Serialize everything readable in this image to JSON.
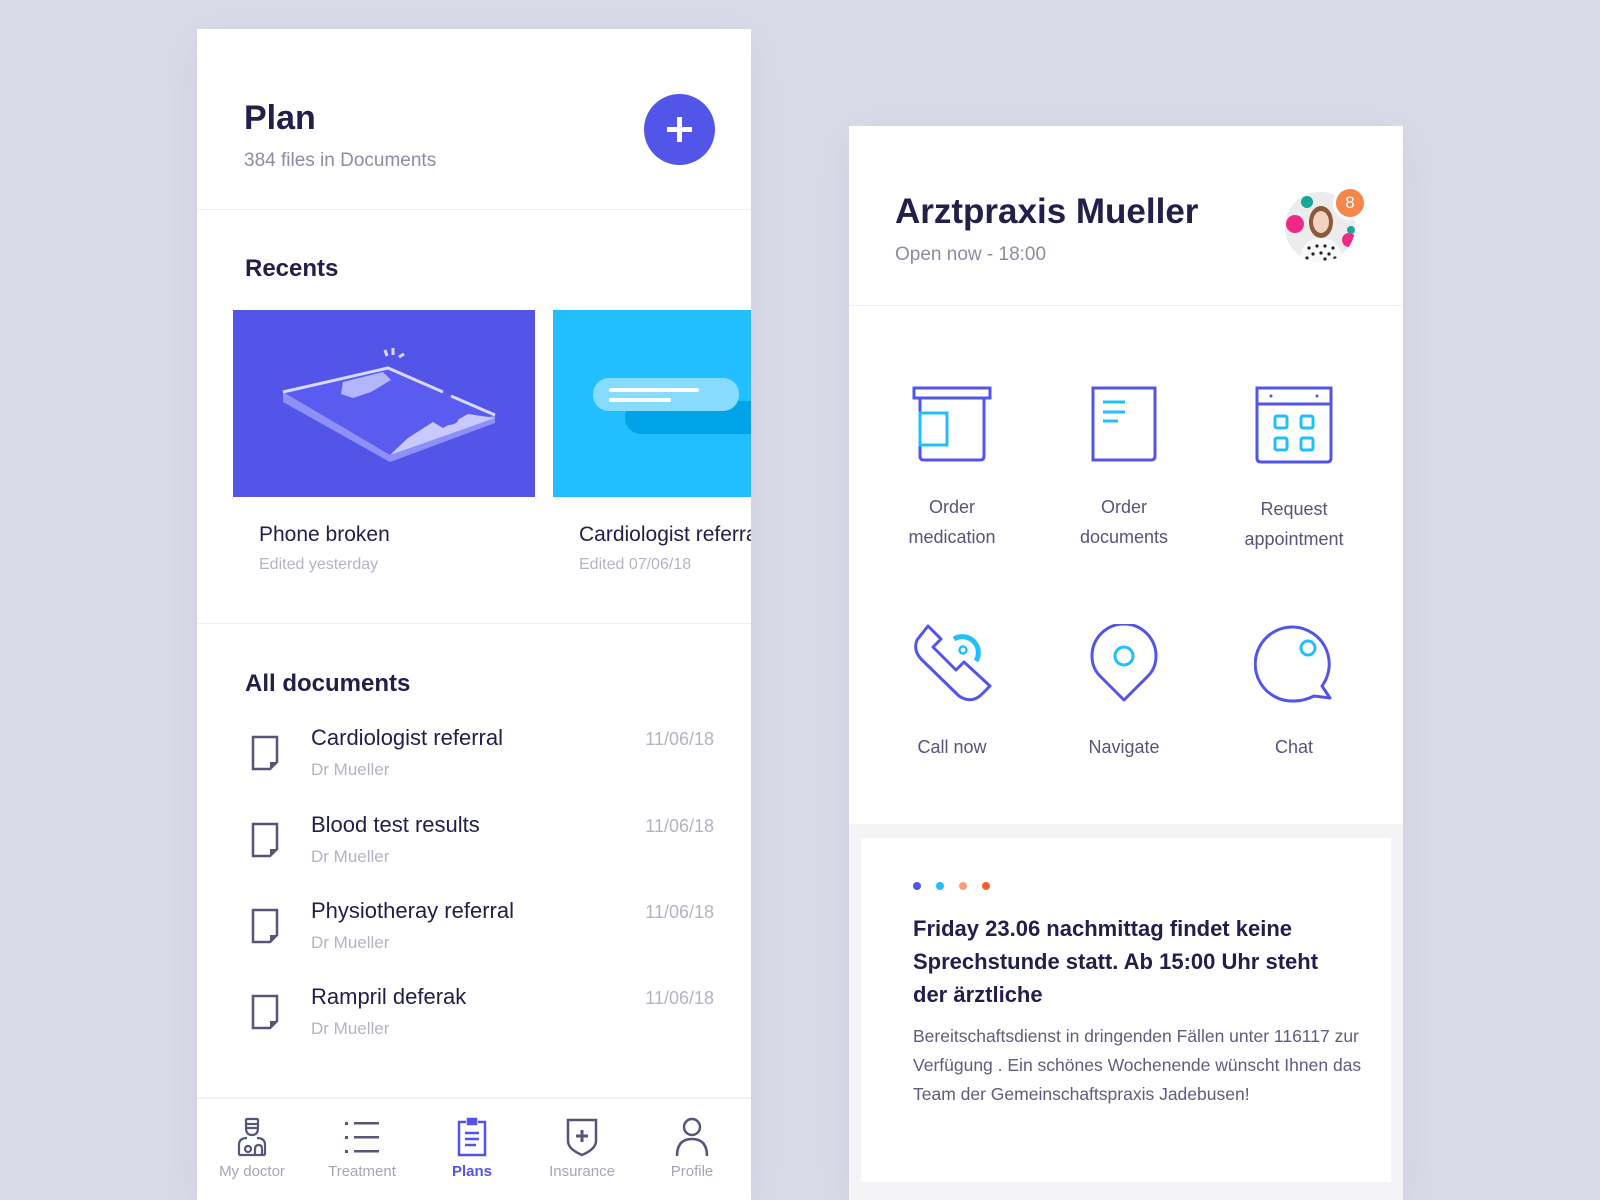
{
  "left_screen": {
    "header": {
      "title": "Plan",
      "subtitle": "384 files in Documents",
      "add_button_label": "+"
    },
    "recents": {
      "title": "Recents",
      "items": [
        {
          "title": "Phone broken",
          "subtitle": "Edited yesterday",
          "thumb_color": "#5255e8",
          "illustration": "broken-phone-illustration"
        },
        {
          "title": "Cardiologist referral",
          "subtitle": "Edited 07/06/18",
          "thumb_color": "#22bfff",
          "illustration": "chat-bubble-illustration"
        }
      ]
    },
    "all_documents": {
      "title": "All documents",
      "items": [
        {
          "title": "Cardiologist referral",
          "author": "Dr Mueller",
          "date": "11/06/18"
        },
        {
          "title": "Blood test results",
          "author": "Dr Mueller",
          "date": "11/06/18"
        },
        {
          "title": "Physiotheray referral",
          "author": "Dr Mueller",
          "date": "11/06/18"
        },
        {
          "title": "Rampril deferak",
          "author": "Dr Mueller",
          "date": "11/06/18"
        }
      ]
    },
    "tabbar": {
      "active": "Plans",
      "tabs": [
        {
          "label": "My doctor",
          "icon": "doctor-icon"
        },
        {
          "label": "Treatment",
          "icon": "list-icon"
        },
        {
          "label": "Plans",
          "icon": "clipboard-icon"
        },
        {
          "label": "Insurance",
          "icon": "shield-plus-icon"
        },
        {
          "label": "Profile",
          "icon": "person-icon"
        }
      ]
    }
  },
  "right_screen": {
    "header": {
      "title": "Arztpraxis Mueller",
      "subtitle": "Open now - 18:00",
      "notification_count": "8"
    },
    "actions": [
      {
        "line1": "Order",
        "line2": "medication",
        "icon": "medication-jar-icon"
      },
      {
        "line1": "Order",
        "line2": "documents",
        "icon": "document-icon"
      },
      {
        "line1": "Request",
        "line2": "appointment",
        "icon": "calendar-icon"
      },
      {
        "line1": "Call now",
        "line2": "",
        "icon": "phone-icon"
      },
      {
        "line1": "Navigate",
        "line2": "",
        "icon": "map-pin-icon"
      },
      {
        "line1": "Chat",
        "line2": "",
        "icon": "chat-bubble-icon"
      }
    ],
    "notice": {
      "dot_colors": [
        "#5255e8",
        "#22bfff",
        "#f4a07a",
        "#f4622b"
      ],
      "title": "Friday 23.06 nachmittag findet keine Sprechstunde statt. Ab 15:00 Uhr steht der ärztliche",
      "body": "Bereitschaftsdienst in dringenden Fällen unter 116117 zur Verfügung . Ein schönes Wochenende wünscht Ihnen das Team der Gemeinschaftspraxis Jadebusen!"
    }
  },
  "colors": {
    "primary": "#5255e8",
    "accent": "#22bfff",
    "badge": "#f4874b",
    "text_dark": "#22204a",
    "text_muted": "#b4b3c6",
    "background": "#dadbe8"
  }
}
